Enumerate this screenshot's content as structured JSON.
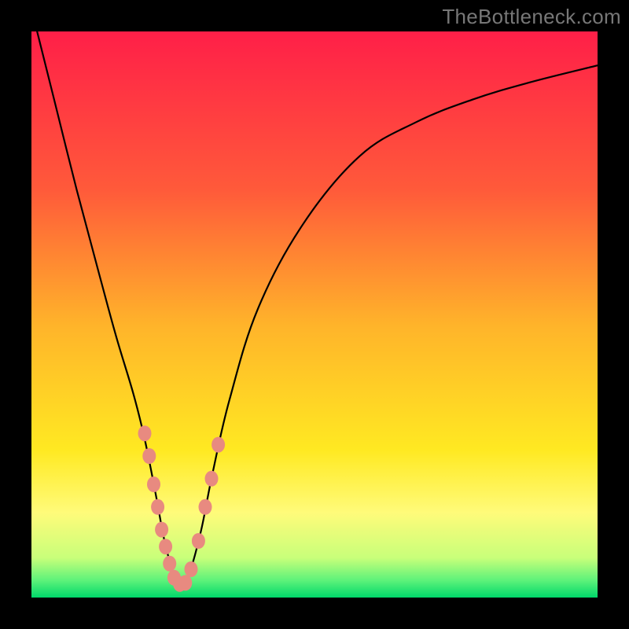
{
  "watermark": "TheBottleneck.com",
  "chart_data": {
    "type": "line",
    "title": "",
    "xlabel": "",
    "ylabel": "",
    "xlim": [
      0,
      100
    ],
    "ylim": [
      0,
      100
    ],
    "gradient_stops": [
      {
        "pct": 0.0,
        "color": "#ff1f48"
      },
      {
        "pct": 28.0,
        "color": "#ff5a3a"
      },
      {
        "pct": 52.0,
        "color": "#ffb42a"
      },
      {
        "pct": 74.0,
        "color": "#ffe922"
      },
      {
        "pct": 85.0,
        "color": "#fffb7a"
      },
      {
        "pct": 93.0,
        "color": "#c8ff7a"
      },
      {
        "pct": 97.0,
        "color": "#5cf27a"
      },
      {
        "pct": 100.0,
        "color": "#00d86a"
      }
    ],
    "series": [
      {
        "name": "v-curve",
        "x": [
          0,
          4,
          8,
          12,
          15,
          18,
          20,
          22,
          23.5,
          25,
          26,
          27,
          28,
          30,
          32,
          35,
          40,
          48,
          58,
          68,
          78,
          88,
          100
        ],
        "y": [
          104,
          88,
          72,
          57,
          46,
          36,
          28,
          18,
          10,
          4.5,
          2.5,
          2.5,
          4.5,
          12,
          22,
          35,
          51,
          66,
          78,
          84,
          88,
          91,
          94
        ]
      }
    ],
    "markers": {
      "name": "salmon-dots",
      "color": "#e88a80",
      "points": [
        {
          "x": 20.0,
          "y": 29
        },
        {
          "x": 20.8,
          "y": 25
        },
        {
          "x": 21.6,
          "y": 20
        },
        {
          "x": 22.3,
          "y": 16
        },
        {
          "x": 23.0,
          "y": 12
        },
        {
          "x": 23.7,
          "y": 9
        },
        {
          "x": 24.4,
          "y": 6
        },
        {
          "x": 25.2,
          "y": 3.5
        },
        {
          "x": 26.2,
          "y": 2.4
        },
        {
          "x": 27.2,
          "y": 2.6
        },
        {
          "x": 28.2,
          "y": 5
        },
        {
          "x": 29.5,
          "y": 10
        },
        {
          "x": 30.7,
          "y": 16
        },
        {
          "x": 31.8,
          "y": 21
        },
        {
          "x": 33.0,
          "y": 27
        }
      ]
    }
  }
}
